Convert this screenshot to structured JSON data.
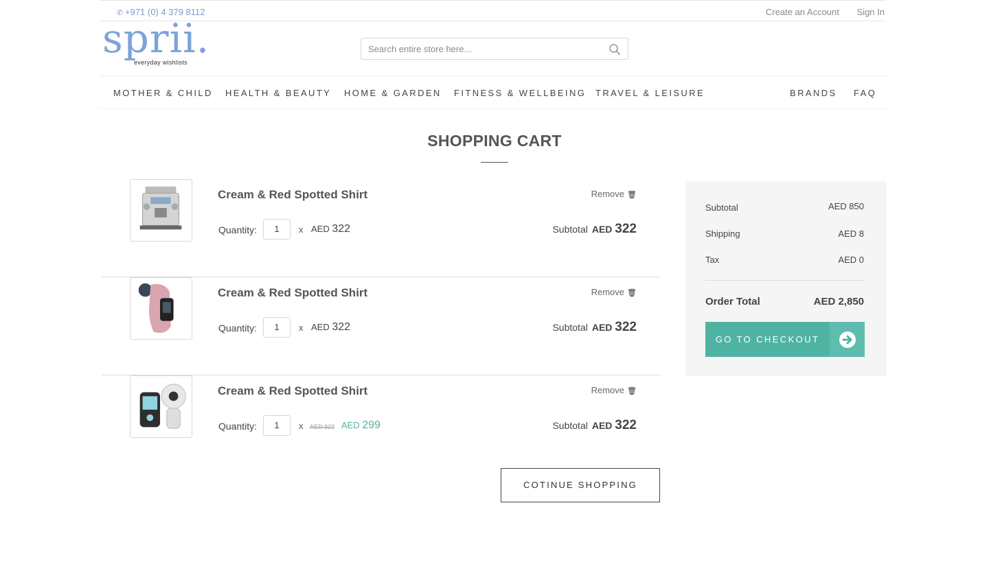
{
  "header": {
    "phone": "+971 (0) 4 379 8112",
    "create_account": "Create an Account",
    "sign_in": "Sign In",
    "logo_word": "sprii.",
    "logo_tagline": "everyday wishlists",
    "search_placeholder": "Search entire store here..."
  },
  "nav": [
    "MOTHER & CHILD",
    "HEALTH & BEAUTY",
    "HOME & GARDEN",
    "FITNESS & WELLBEING",
    "TRAVEL & LEISURE",
    "BRANDS",
    "FAQ"
  ],
  "page_title": "SHOPPING CART",
  "cart": {
    "qty_label": "Quantity:",
    "remove_label": "Remove",
    "subtotal_label": "Subtotal",
    "currency": "AED",
    "items": [
      {
        "name": "Cream & Red Spotted Shirt",
        "image": "coffee-machine",
        "quantity": "1",
        "price": "322",
        "subtotal": "322"
      },
      {
        "name": "Cream & Red Spotted Shirt",
        "image": "fitness-tracker",
        "quantity": "1",
        "price": "322",
        "subtotal": "322"
      },
      {
        "name": "Cream & Red Spotted Shirt",
        "image": "baby-monitor",
        "quantity": "1",
        "old_price": "AED 322",
        "price": "299",
        "subtotal": "322"
      }
    ],
    "continue_label": "COTINUE SHOPPING"
  },
  "summary": {
    "subtotal_label": "Subtotal",
    "subtotal_value": "AED 850",
    "shipping_label": "Shipping",
    "shipping_value": "AED 8",
    "tax_label": "Tax",
    "tax_value": "AED 0",
    "total_label": "Order Total",
    "total_value": "AED 2,850",
    "checkout_label": "GO TO CHECKOUT"
  },
  "colors": {
    "accent": "#4fb3a3",
    "logo": "#7ca3d9",
    "summary_bg": "#f5f5f5"
  }
}
